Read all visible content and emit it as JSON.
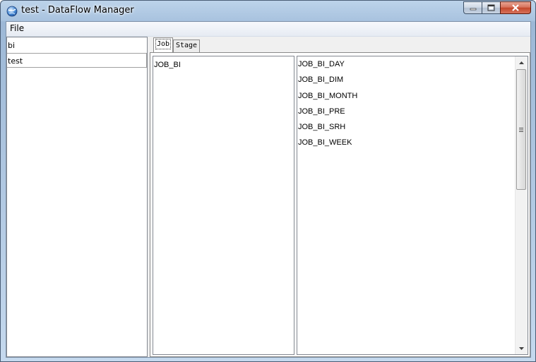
{
  "window": {
    "title": "test - DataFlow Manager"
  },
  "menu": {
    "file": "File"
  },
  "left_list": {
    "items": [
      "bi",
      "test"
    ],
    "selected": "test"
  },
  "tabs": [
    {
      "label": "Job",
      "active": true
    },
    {
      "label": "Stage",
      "active": false
    }
  ],
  "jobs": [
    "JOB_BI"
  ],
  "stages": [
    "JOB_BI_DAY",
    "JOB_BI_DIM",
    "JOB_BI_MONTH",
    "JOB_BI_PRE",
    "JOB_BI_SRH",
    "JOB_BI_WEEK"
  ],
  "icons": {
    "app": "globe-icon",
    "minimize": "minimize-icon",
    "maximize": "maximize-icon",
    "close": "close-icon",
    "scroll_up": "arrow-up-icon",
    "scroll_down": "arrow-down-icon",
    "thumb_grip": "grip-icon"
  },
  "colors": {
    "titlebar": "#a9c3df",
    "close_button": "#c4472b",
    "client_bg": "#f0f0f0"
  }
}
